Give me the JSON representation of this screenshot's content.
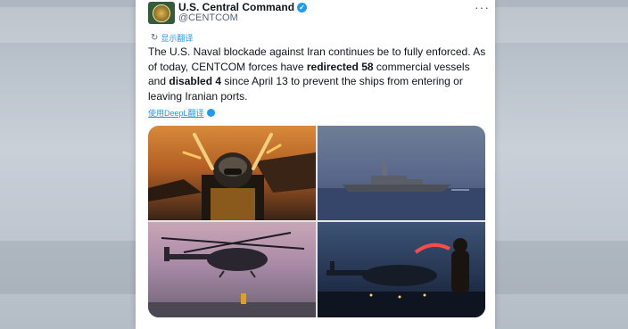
{
  "account": {
    "display_name": "U.S. Central Command",
    "handle": "@CENTCOM",
    "verified_mark": "✓"
  },
  "translate_label": "显示翻译",
  "tweet": {
    "part1": "The U.S. Naval blockade against Iran continues be to fully enforced. As of today, CENTCOM forces have ",
    "bold1": "redirected 58",
    "part2": " commercial vessels and ",
    "bold2": "disabled 4",
    "part3": " since April 13 to prevent the ships from entering or leaving Iranian ports."
  },
  "deepl_label": "使用DeepL翻译",
  "media": {
    "photo1_icon": "flight-deck-crew",
    "photo2_icon": "destroyer-ship",
    "photo3_icon": "helicopter",
    "photo4_icon": "helicopter-night"
  },
  "colors": {
    "link_blue": "#1d9bf0",
    "text": "#0f1419",
    "secondary": "#536471"
  }
}
